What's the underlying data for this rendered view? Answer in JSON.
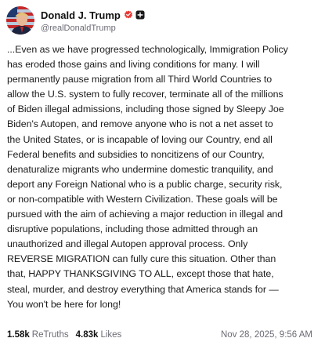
{
  "post": {
    "author": {
      "display_name": "Donald J. Trump",
      "handle": "@realDonaldTrump",
      "verified_icon": "verified-badge-icon",
      "follow_icon": "follow-plus-icon"
    },
    "body_lines": [
      "...Even as we have progressed technologically, Immigration Policy",
      "has eroded those gains and living conditions for many. I will",
      "permanently pause migration from all Third World Countries to",
      "allow the U.S. system to fully recover, terminate all of the millions",
      "of Biden illegal admissions, including those signed by Sleepy Joe",
      "Biden's Autopen, and remove anyone who is not a net asset to",
      "the United States, or is incapable of loving our Country, end all",
      "Federal benefits and subsidies to noncitizens of our Country,",
      "denaturalize migrants who undermine domestic tranquility, and",
      "deport any Foreign National who is a public charge, security risk,",
      "or non-compatible with Western Civilization. These goals will be",
      "pursued with the aim of achieving a major reduction in illegal and",
      "disruptive populations, including those admitted through an",
      "unauthorized and illegal Autopen approval process. Only",
      "REVERSE MIGRATION can fully cure this situation. Other than",
      "that, HAPPY THANKSGIVING TO ALL, except those that hate,",
      "steal, murder, and destroy everything that America stands for —",
      "You won't be here for long!"
    ],
    "stats": {
      "retruths_count": "1.58k",
      "retruths_label": "ReTruths",
      "likes_count": "4.83k",
      "likes_label": "Likes"
    },
    "timestamp": "Nov 28, 2025, 9:56 AM"
  },
  "colors": {
    "verified_badge": "#e53935",
    "follow_button": "#1a1a1a",
    "secondary_text": "#6b6b75",
    "primary_text": "#1b1b1b"
  }
}
